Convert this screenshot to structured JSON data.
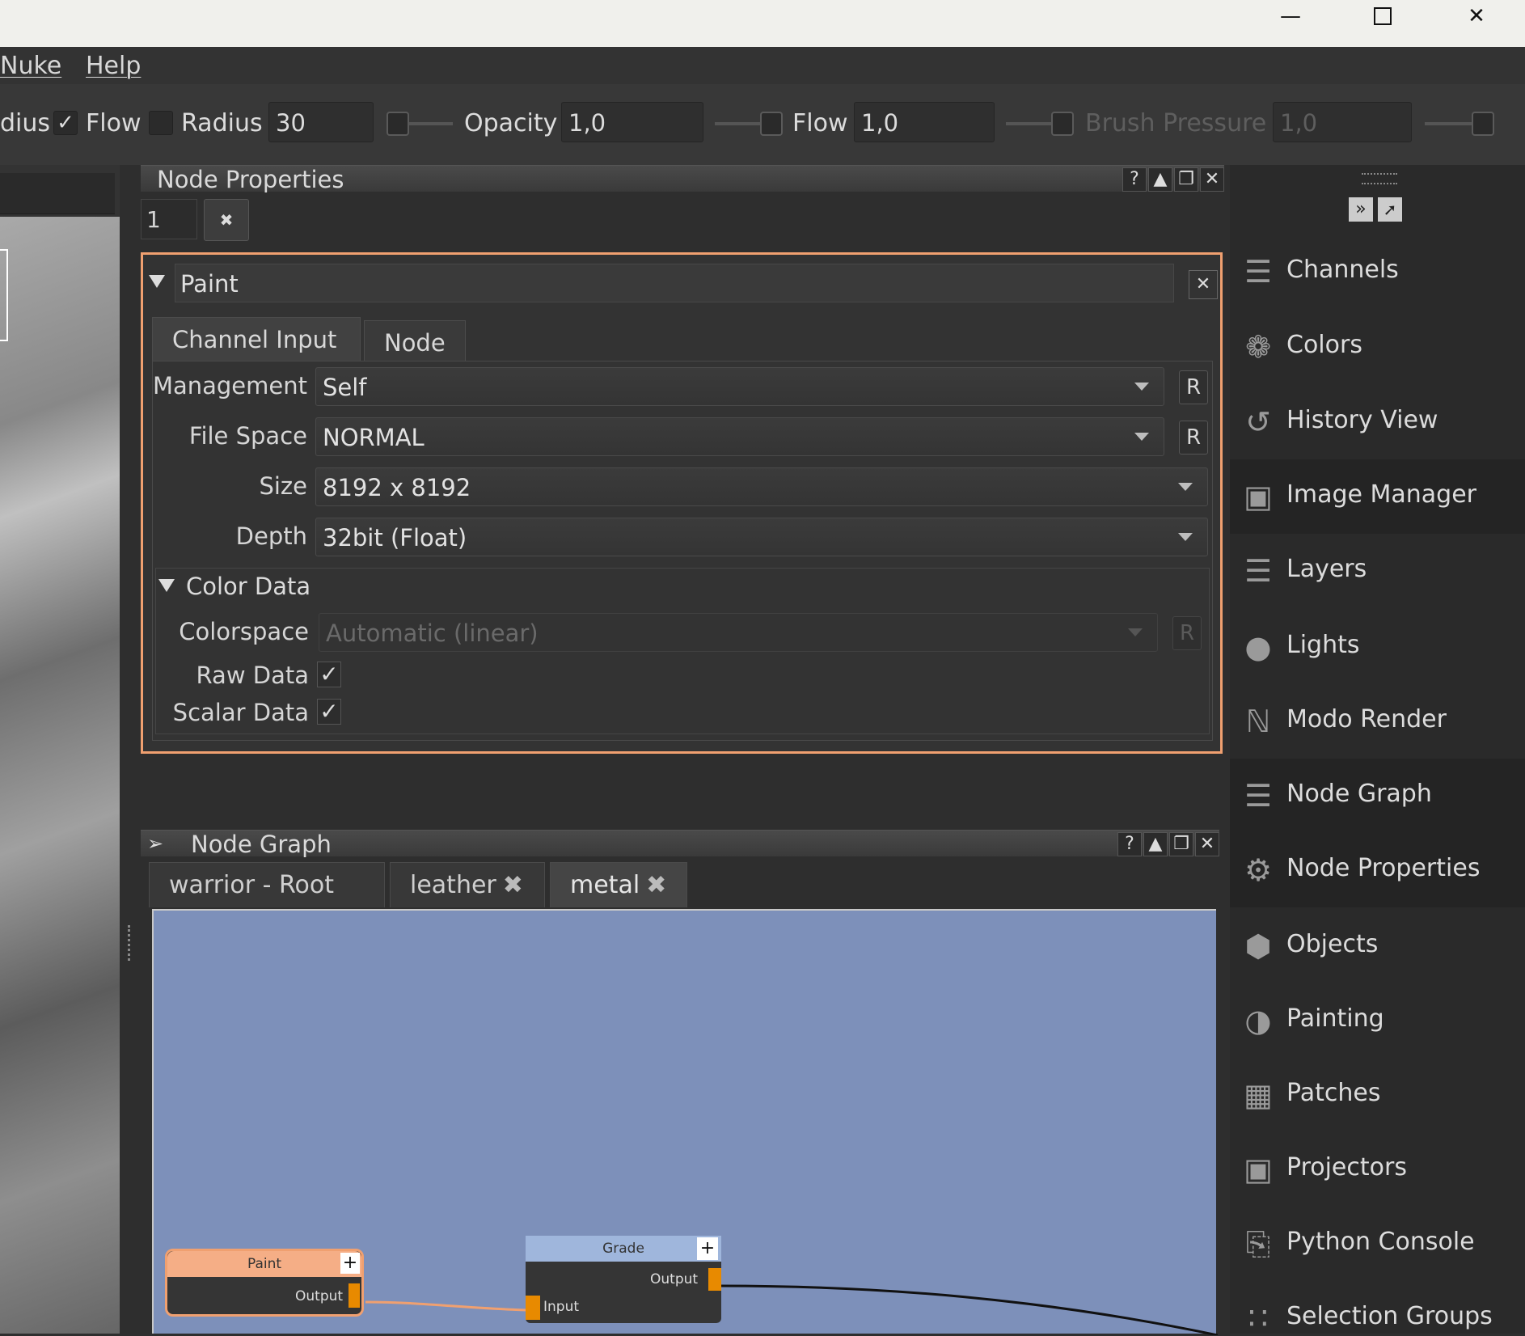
{
  "menu": {
    "nuke": "Nuke",
    "help": "Help"
  },
  "toolbar": {
    "radius_cut": "dius",
    "flow_label": "Flow",
    "radius_label": "Radius",
    "radius_value": "30",
    "opacity_label": "Opacity",
    "opacity_value": "1,0",
    "flow2_label": "Flow",
    "flow2_value": "1,0",
    "brush_pressure_label": "Brush Pressure",
    "brush_pressure_value": "1,0",
    "flow_checked": true,
    "radius_checked": false
  },
  "node_properties": {
    "title": "Node Properties",
    "count_value": "1",
    "node_name": "Paint",
    "tabs": [
      "Channel Input",
      "Node"
    ],
    "fields": {
      "management_label": "Management",
      "management_value": "Self",
      "file_space_label": "File Space",
      "file_space_value": "NORMAL",
      "size_label": "Size",
      "size_value": "8192 x 8192",
      "depth_label": "Depth",
      "depth_value": "32bit (Float)"
    },
    "reset_label": "R",
    "color_data": {
      "title": "Color Data",
      "colorspace_label": "Colorspace",
      "colorspace_value": "Automatic (linear)",
      "raw_data_label": "Raw Data",
      "scalar_data_label": "Scalar Data",
      "raw_data_checked": true,
      "scalar_data_checked": true
    },
    "accent_color": "#f0a070"
  },
  "node_graph": {
    "title": "Node Graph",
    "tabs": [
      "warrior - Root",
      "leather",
      "metal"
    ],
    "canvas_color": "#7d90ba",
    "nodes": {
      "paint_title": "Paint",
      "paint_output": "Output",
      "grade_title": "Grade",
      "grade_output": "Output",
      "grade_input": "Input"
    }
  },
  "sidebar": {
    "items": [
      {
        "label": "Channels",
        "icon": "channels-icon"
      },
      {
        "label": "Colors",
        "icon": "colors-icon"
      },
      {
        "label": "History View",
        "icon": "history-icon"
      },
      {
        "label": "Image Manager",
        "icon": "image-manager-icon"
      },
      {
        "label": "Layers",
        "icon": "layers-icon"
      },
      {
        "label": "Lights",
        "icon": "lights-icon"
      },
      {
        "label": "Modo Render",
        "icon": "modo-render-icon"
      },
      {
        "label": "Node Graph",
        "icon": "node-graph-icon"
      },
      {
        "label": "Node Properties",
        "icon": "node-properties-icon"
      },
      {
        "label": "Objects",
        "icon": "objects-icon"
      },
      {
        "label": "Painting",
        "icon": "painting-icon"
      },
      {
        "label": "Patches",
        "icon": "patches-icon"
      },
      {
        "label": "Projectors",
        "icon": "projectors-icon"
      },
      {
        "label": "Python Console",
        "icon": "python-console-icon"
      },
      {
        "label": "Selection Groups",
        "icon": "selection-groups-icon"
      }
    ]
  }
}
